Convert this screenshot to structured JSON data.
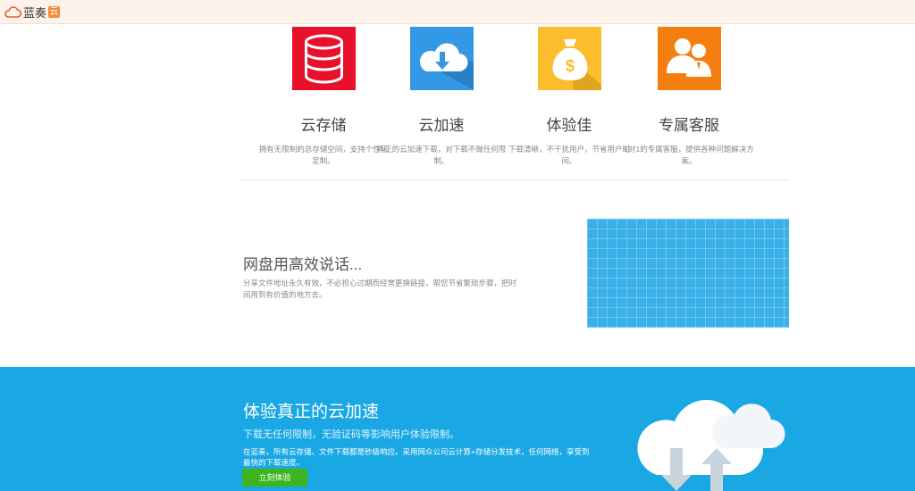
{
  "header": {
    "logo_text": "蓝奏",
    "logo_badge": "云"
  },
  "features": [
    {
      "icon": "database-icon",
      "title": "云存储",
      "desc": "拥有无限制的总存储空间，支持个性化定制。",
      "color": "#e8102a"
    },
    {
      "icon": "cloud-download-icon",
      "title": "云加速",
      "desc": "真正的云加速下载，对下载不做任何限制。",
      "color": "#3399e6"
    },
    {
      "icon": "money-bag-icon",
      "title": "体验佳",
      "desc": "下载清晰，不干扰用户，节省用户时间。",
      "color": "#fbbd2b"
    },
    {
      "icon": "customer-service-icon",
      "title": "专属客服",
      "desc": "1对1的专属客服，提供各种问题解决方案。",
      "color": "#f57e10"
    }
  ],
  "middle": {
    "title": "网盘用高效说话...",
    "desc": "分享文件地址永久有效，不必担心过期而经常更换链接，帮您节省繁琐步骤，把时间用到有价值的地方去。"
  },
  "band": {
    "title": "体验真正的云加速",
    "subtitle": "下载无任何限制，无验证码等影响用户体验限制。",
    "desc": "在蓝奏，所有云存储、文件下载都是秒级响应。采用网众公司云计算+存储分发技术，任何网络，享受到最快的下载速度。",
    "button_label": "立刻体验",
    "button_color": "#3cb521",
    "background": "#1aa8e4"
  }
}
